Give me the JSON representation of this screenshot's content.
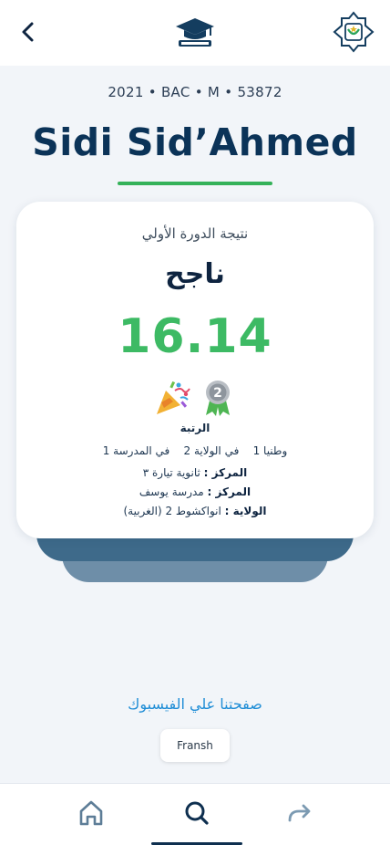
{
  "header": {
    "back_icon": "chevron-left-icon",
    "logo_icon": "graduation-cap-icon",
    "emblem_icon": "emblem-icon"
  },
  "student": {
    "meta": "2021 • BAC • M • 53872",
    "name": "Sidi Sid’Ahmed"
  },
  "result": {
    "session_label": "نتيجة الدورة الأولي",
    "decision": "ناجح",
    "score": "16.14",
    "rank_label": "الرتبة",
    "rank_line": "وطنيا 1    في الولاية 2    في المدرسة 1",
    "center_label": "المركز :",
    "center_value": "ثانوية  تيارة ٣",
    "school_label": "المركز :",
    "school_value": "مدرسة يوسف",
    "wilaya_label": "الولاية :",
    "wilaya_value": "انواكشوط 2 (الغربية)",
    "medal_number": "2"
  },
  "footer": {
    "facebook_link": "صفحتنا علي الفيسبوك",
    "language_button": "Fransh"
  },
  "nav": {
    "items": [
      "home-icon",
      "search-icon",
      "share-icon"
    ],
    "active": "search-icon"
  },
  "colors": {
    "accent_green": "#3dba64",
    "navy": "#0b3358",
    "link_blue": "#1f8dd6"
  }
}
